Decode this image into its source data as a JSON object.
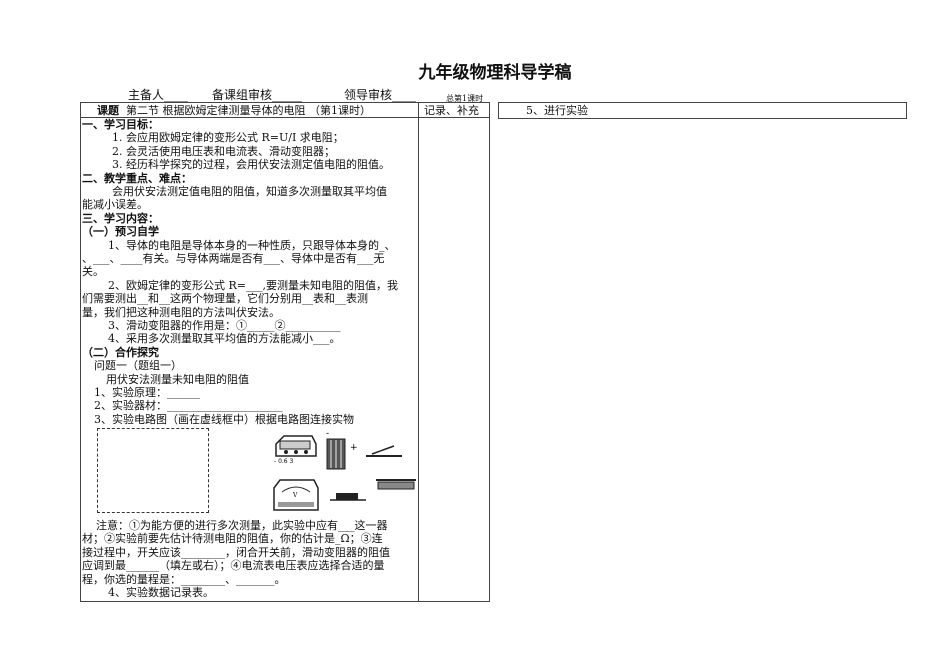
{
  "title": "九年级物理科导学稿",
  "header": {
    "lead": "主备人____",
    "group": "备课组审核_____",
    "leader": "领导审核____",
    "total": "总第1课时"
  },
  "table": {
    "topic_label": "课题",
    "topic": "第二节 根据欧姆定律测量导体的电阻 （第1课时）",
    "notes_header": "记录、补充"
  },
  "right": {
    "step5": "5、进行实验"
  },
  "lines": [
    {
      "t": "一、学习目标：",
      "b": true,
      "i": 0
    },
    {
      "t": "1. 会应用欧姆定律的变形公式 R=U/I 求电阻；",
      "i": 30
    },
    {
      "t": "2. 会灵活使用电压表和电流表、滑动变阻器；",
      "i": 30
    },
    {
      "t": "3. 经历科学探究的过程，会用伏安法测定值电阻的阻值。",
      "i": 30
    },
    {
      "t": "二、教学重点、难点：",
      "b": true,
      "i": 0
    },
    {
      "t": "会用伏安法测定值电阻的阻值，知道多次测量取其平均值",
      "i": 30
    },
    {
      "t": "能减小误差。",
      "i": 0
    },
    {
      "t": "三、学习内容：",
      "b": true,
      "i": 0
    },
    {
      "t": "（一）预习自学",
      "b": true,
      "i": 0
    },
    {
      "t": "1、导体的电阻是导体本身的一种性质，只跟导体本身的_、",
      "i": 26
    },
    {
      "t": "、___、____有关。与导体两端是否有___、导体中是否有___无",
      "i": 0
    },
    {
      "t": "关。",
      "i": 0
    },
    {
      "t": "2、欧姆定律的变形公式 R=___,要测量未知电阻的阻值，我",
      "i": 26
    },
    {
      "t": "们需要测出__和__这两个物理量，它们分别用__表和__表测",
      "i": 0
    },
    {
      "t": "量，我们把这种测电阻的方法叫伏安法。",
      "i": 0
    },
    {
      "t": "3、滑动变阻器的作用是：①_____②__________",
      "i": 26
    },
    {
      "t": "4、采用多次测量取其平均值的方法能减小___。",
      "i": 26
    },
    {
      "t": "（二）合作探究",
      "b": true,
      "i": 0
    },
    {
      "t": "问题一（题组一）",
      "i": 12
    },
    {
      "t": "用伏安法测量未知电阻的阻值",
      "i": 24
    },
    {
      "t": "1、实验原理：______",
      "i": 12
    },
    {
      "t": "2、实验器材：_____________________",
      "i": 12
    },
    {
      "t": "3、实验电路图（画在虚线框中）根据电路图连接实物",
      "i": 12
    }
  ],
  "notes": [
    {
      "t": "注意：①为能方便的进行多次测量，此实验中应有___这一器",
      "i": 14
    },
    {
      "t": "材；②实验前要先估计待测电阻的阻值，你的估计是_Ω；③连",
      "i": 0
    },
    {
      "t": "接过程中，开关应该________，闭合开关前，滑动变阻器的阻值",
      "i": 0
    },
    {
      "t": "应调到最______（填左或右）；④电流表电压表应选择合适的量",
      "i": 0
    },
    {
      "t": "程，你选的量程是：________、_______。",
      "i": 0
    },
    {
      "t": "4、实验数据记录表。",
      "i": 26
    }
  ],
  "apparatus": {
    "ammeter_scale": "- 0.6 3",
    "voltmeter_mark": "V",
    "battery_minus": "-",
    "battery_plus": "+"
  }
}
